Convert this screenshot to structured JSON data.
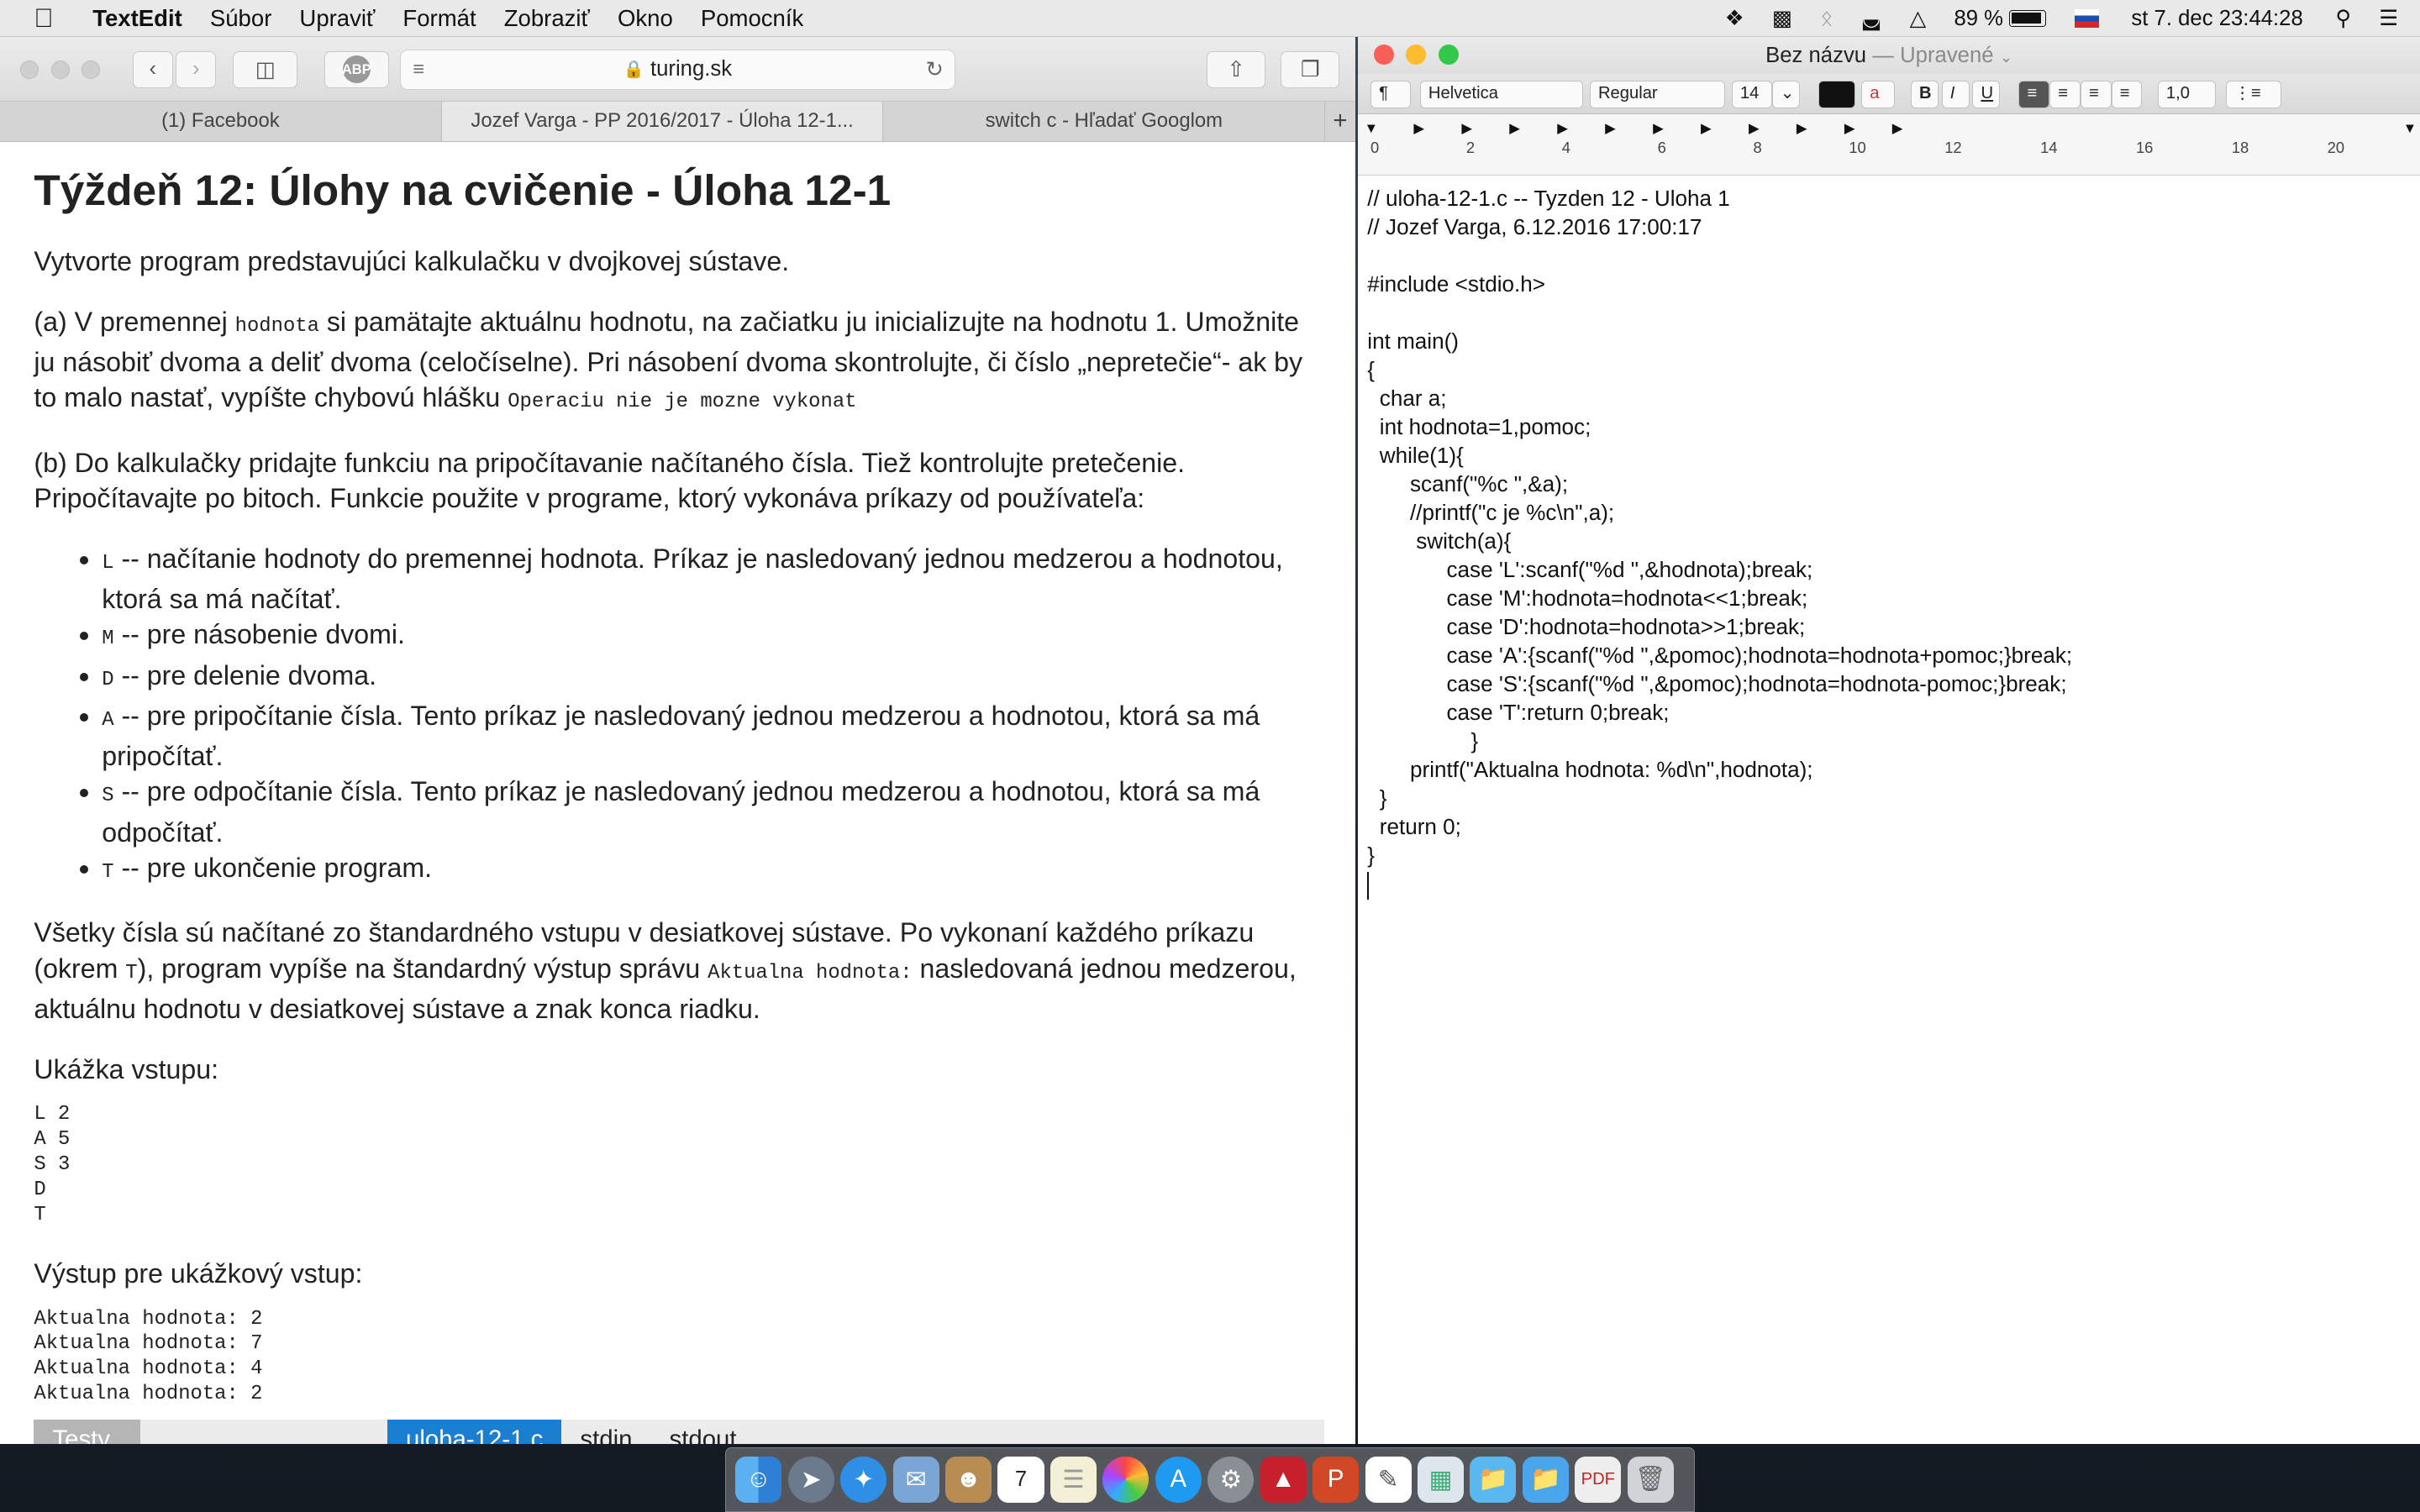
{
  "menubar": {
    "apple_icon": "apple-logo",
    "app_name": "TextEdit",
    "items": [
      "Súbor",
      "Upraviť",
      "Formát",
      "Zobraziť",
      "Okno",
      "Pomocník"
    ],
    "battery": "89 %",
    "datetime": "st 7. dec  23:44:28"
  },
  "safari": {
    "url": "turing.sk",
    "tabs": [
      "(1) Facebook",
      "Jozef Varga - PP 2016/2017 - Úloha 12-1...",
      "switch c - Hľadať Googlom"
    ],
    "new_tab": "+",
    "abp_label": "ABP",
    "page": {
      "title": "Týždeň 12: Úlohy na cvičenie - Úloha 12-1",
      "intro": "Vytvorte program predstavujúci kalkulačku v dvojkovej sústave.",
      "a_1": "(a) V premennej ",
      "a_code1": "hodnota",
      "a_2": " si pamätajte aktuálnu hodnotu, na začiatku ju inicializujte na hodnotu 1. Umožnite ju násobiť dvoma a deliť dvoma (celočíselne). Pri násobení dvoma skontrolujte, či číslo „nepretečie“- ak by to malo nastať, vypíšte chybovú hlášku ",
      "a_code2": "Operaciu nie je mozne vykonat",
      "b_text": "(b) Do kalkulačky pridajte funkciu na pripočítavanie načítaného čísla. Tiež kontrolujte pretečenie. Pripočítavajte po bitoch. Funkcie použite v programe, ktorý vykonáva príkazy od používateľa:",
      "list": [
        {
          "code": "L",
          "text": " -- načítanie hodnoty do premennej hodnota. Príkaz je nasledovaný jednou medzerou a hodnotou, ktorá sa má načítať."
        },
        {
          "code": "M",
          "text": " -- pre násobenie dvomi."
        },
        {
          "code": "D",
          "text": " -- pre delenie dvoma."
        },
        {
          "code": "A",
          "text": " -- pre pripočítanie čísla. Tento príkaz je nasledovaný jednou medzerou a hodnotou, ktorá sa má pripočítať."
        },
        {
          "code": "S",
          "text": " -- pre odpočítanie čísla. Tento príkaz je nasledovaný jednou medzerou a hodnotou, ktorá sa má odpočítať."
        },
        {
          "code": "T",
          "text": " -- pre ukončenie program."
        }
      ],
      "all_1": "Všetky čísla sú načítané zo štandardného vstupu v desiatkovej sústave. Po vykonaní každého príkazu (okrem ",
      "all_code1": "T",
      "all_2": "), program vypíše na štandardný výstup správu ",
      "all_code2": "Aktualna hodnota:",
      "all_3": " nasledovaná jednou medzerou, aktuálnu hodnotu v desiatkovej sústave a znak konca riadku.",
      "sample_in_label": "Ukážka vstupu:",
      "sample_in": "L 2\nA 5\nS 3\nD\nT",
      "sample_out_label": "Výstup pre ukážkový vstup:",
      "sample_out": "Aktualna hodnota: 2\nAktualna hodnota: 7\nAktualna hodnota: 4\nAktualna hodnota: 2",
      "bottom_tabs": [
        "Testy",
        "uloha-12-1.c",
        "stdin",
        "stdout"
      ]
    }
  },
  "textedit": {
    "title": "Bez názvu",
    "edited": "— Upravené",
    "font_family": "Helvetica",
    "font_style": "Regular",
    "font_size": "14",
    "line_spacing": "1,0",
    "ruler_numbers": [
      "0",
      "2",
      "4",
      "6",
      "8",
      "10",
      "12",
      "14",
      "16",
      "18",
      "20"
    ],
    "document": "// uloha-12-1.c -- Tyzden 12 - Uloha 1\n// Jozef Varga, 6.12.2016 17:00:17\n\n#include <stdio.h>\n\nint main()\n{\n  char a;\n  int hodnota=1,pomoc;\n  while(1){\n       scanf(\"%c \",&a);\n       //printf(\"c je %c\\n\",a);\n        switch(a){\n             case 'L':scanf(\"%d \",&hodnota);break;\n             case 'M':hodnota=hodnota<<1;break;\n             case 'D':hodnota=hodnota>>1;break;\n             case 'A':{scanf(\"%d \",&pomoc);hodnota=hodnota+pomoc;}break;\n             case 'S':{scanf(\"%d \",&pomoc);hodnota=hodnota-pomoc;}break;\n             case 'T':return 0;break;\n                 }\n       printf(\"Aktualna hodnota: %d\\n\",hodnota);\n  }\n  return 0;\n}\n"
  },
  "colors": {
    "close": "#fc5f57",
    "minimize": "#fdbc2e",
    "zoom": "#34c84a",
    "active_tab_blue": "#1b7fd1"
  },
  "dock": {
    "icons": [
      "finder-icon",
      "launchpad-icon",
      "safari-icon",
      "mail-icon",
      "contacts-icon",
      "calendar-icon",
      "notes-icon",
      "photos-icon",
      "app-store-icon",
      "system-preferences-icon",
      "autocad-icon",
      "powerpoint-icon",
      "textedit-icon",
      "preview-icon",
      "folder-icon",
      "downloads-icon",
      "pdf-icon",
      "trash-icon"
    ],
    "calendar_day": "7"
  }
}
